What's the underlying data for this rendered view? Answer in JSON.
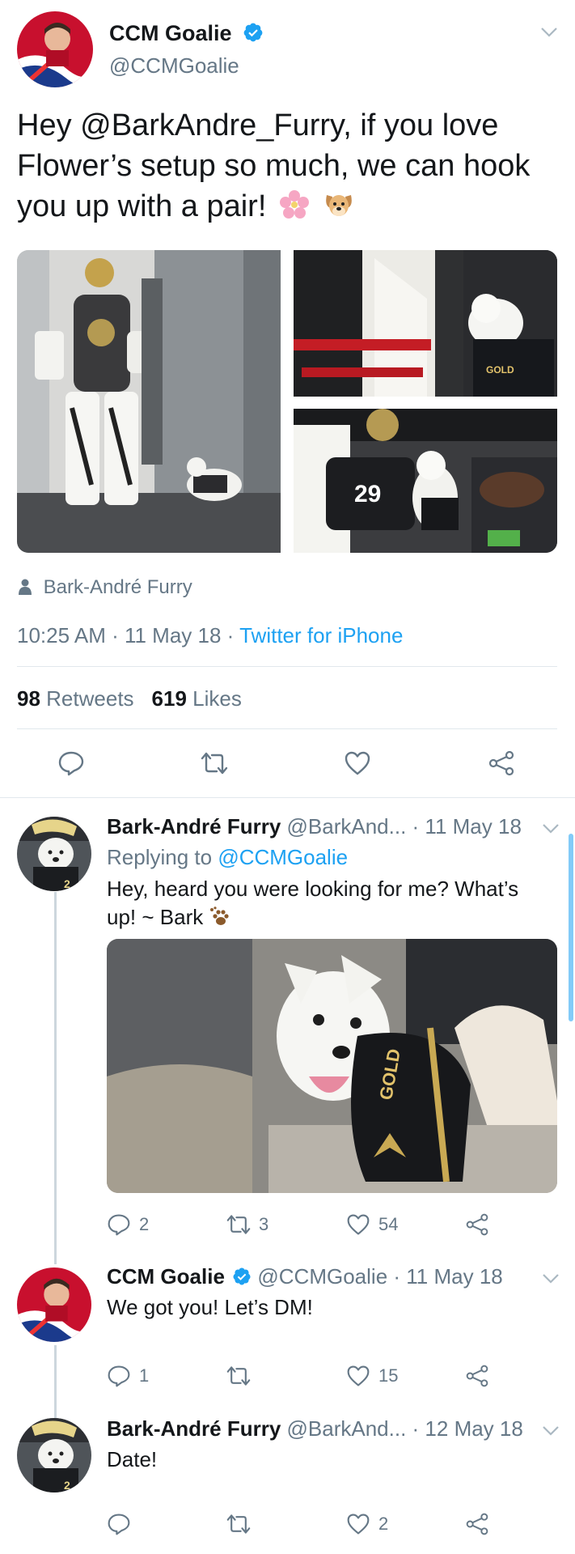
{
  "main_tweet": {
    "author_name": "CCM Goalie",
    "author_handle": "@CCMGoalie",
    "verified": true,
    "text": "Hey @BarkAndre_Furry, if you love Flower’s setup so much, we can hook you up with a pair!",
    "emojis": [
      "cherry-blossom",
      "dog-face"
    ],
    "tagged_user": "Bark-André Furry",
    "time": "10:25 AM",
    "date": "11 May 18",
    "source": "Twitter for iPhone",
    "separator": " · ",
    "retweets_count": "98",
    "retweets_label": "Retweets",
    "likes_count": "619",
    "likes_label": "Likes"
  },
  "replies": [
    {
      "author_name": "Bark-André Furry",
      "author_handle": "@BarkAnd...",
      "date": "11 May 18",
      "replying_prefix": "Replying to",
      "replying_to": "@CCMGoalie",
      "text": "Hey, heard you were looking for me? What’s up! ~ Bark",
      "reply_count": "2",
      "retweet_count": "3",
      "like_count": "54"
    },
    {
      "author_name": "CCM Goalie",
      "author_handle": "@CCMGoalie",
      "date": "11 May 18",
      "text": "We got you! Let’s DM!",
      "reply_count": "1",
      "retweet_count": "",
      "like_count": "15"
    },
    {
      "author_name": "Bark-André Furry",
      "author_handle": "@BarkAnd...",
      "date": "12 May 18",
      "text": "Date!",
      "reply_count": "",
      "retweet_count": "",
      "like_count": "2"
    }
  ],
  "colors": {
    "accent": "#1da1f2",
    "text": "#14171a",
    "secondary": "#657786",
    "divider": "#e1e8ed"
  }
}
